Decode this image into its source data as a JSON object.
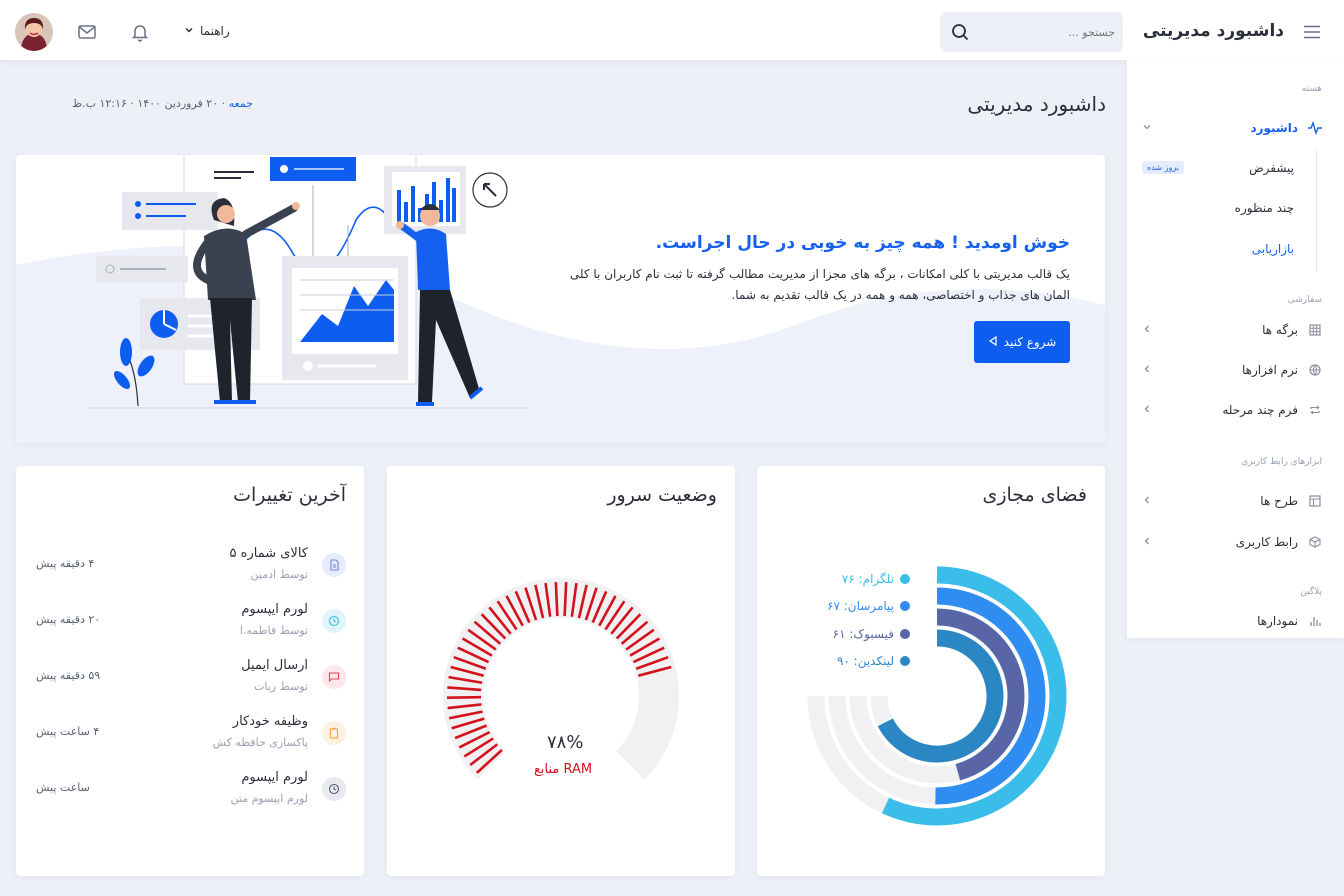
{
  "topbar": {
    "brand": "داشبورد مدیریتی",
    "search_placeholder": "جستجو ...",
    "help_label": "راهنما"
  },
  "sidebar": {
    "section_core": "هسته",
    "dashboard": "داشبورد",
    "sub_items": [
      "پیشفرض",
      "چند منظوره",
      "بازاریابی"
    ],
    "badge": "بروز شده",
    "section_custom": "سفارشی",
    "pages": "برگه ها",
    "software": "نرم افزارها",
    "multistep_form": "فرم چند مرحله",
    "section_ui_tools": "ابزارهای رابط کاربری",
    "layouts": "طرح ها",
    "ui": "رابط کاربری",
    "section_plugins": "پلاگین",
    "charts": "نمودارها"
  },
  "header": {
    "title": "داشبورد مدیریتی",
    "date_day": "جمعه",
    "date_rest": "· ۲۰ فروردین ۱۴۰۰ · ۱۲:۱۶ ب.ظ"
  },
  "hero": {
    "title": "خوش اومدید ! همه چیز به خوبی در حال اجراست.",
    "text": "یک قالب مدیریتی با کلی امکانات ، برگه های مجزا از مدیریت مطالب گرفته تا ثبت نام کاربران با کلی المان های جذاب و اختصاصی، همه و همه در یک قالب تقدیم به شما.",
    "button": "شروع کنید"
  },
  "social": {
    "title": "فضای مجازی",
    "items": [
      {
        "label": "تلگرام: ۷۶",
        "value": 76,
        "color": "#3bbdea"
      },
      {
        "label": "پیامرسان: ۶۷",
        "value": 67,
        "color": "#2f8cf0"
      },
      {
        "label": "فیسبوک: ۶۱",
        "value": 61,
        "color": "#5866a8"
      },
      {
        "label": "لینکدین: ۹۰",
        "value": 90,
        "color": "#2a87c4"
      }
    ]
  },
  "server": {
    "title": "وضعیت سرور",
    "value": "۷۸%",
    "percent": 78,
    "label": "منابع RAM"
  },
  "changes": {
    "title": "آخرین تغییرات",
    "items": [
      {
        "title": "کالای شماره ۵",
        "sub": "توسط ادمین",
        "time": "۴ دقیقه پیش",
        "icon": "doc-icon",
        "bg": "#e7ecfb",
        "fg": "#6a84e0"
      },
      {
        "title": "لورم ایپسوم",
        "sub": "توسط فاطمه.ا",
        "time": "۲۰ دقیقه پیش",
        "icon": "clock-icon",
        "bg": "#dff5f9",
        "fg": "#3bbdea"
      },
      {
        "title": "ارسال ایمیل",
        "sub": "توسط ربات",
        "time": "۵۹ دقیقه پیش",
        "icon": "message-icon",
        "bg": "#fde7ea",
        "fg": "#e2445c"
      },
      {
        "title": "وظیفه خودکار",
        "sub": "پاکسازی حافظه کش",
        "time": "۴ ساعت پیش",
        "icon": "clipboard-icon",
        "bg": "#fdf1e0",
        "fg": "#f2a53b"
      },
      {
        "title": "لورم ایپسوم",
        "sub": "لورم ایپسوم متن",
        "time": "ساعت پیش",
        "icon": "clock-icon",
        "bg": "#e9eaef",
        "fg": "#5a6072"
      }
    ]
  }
}
